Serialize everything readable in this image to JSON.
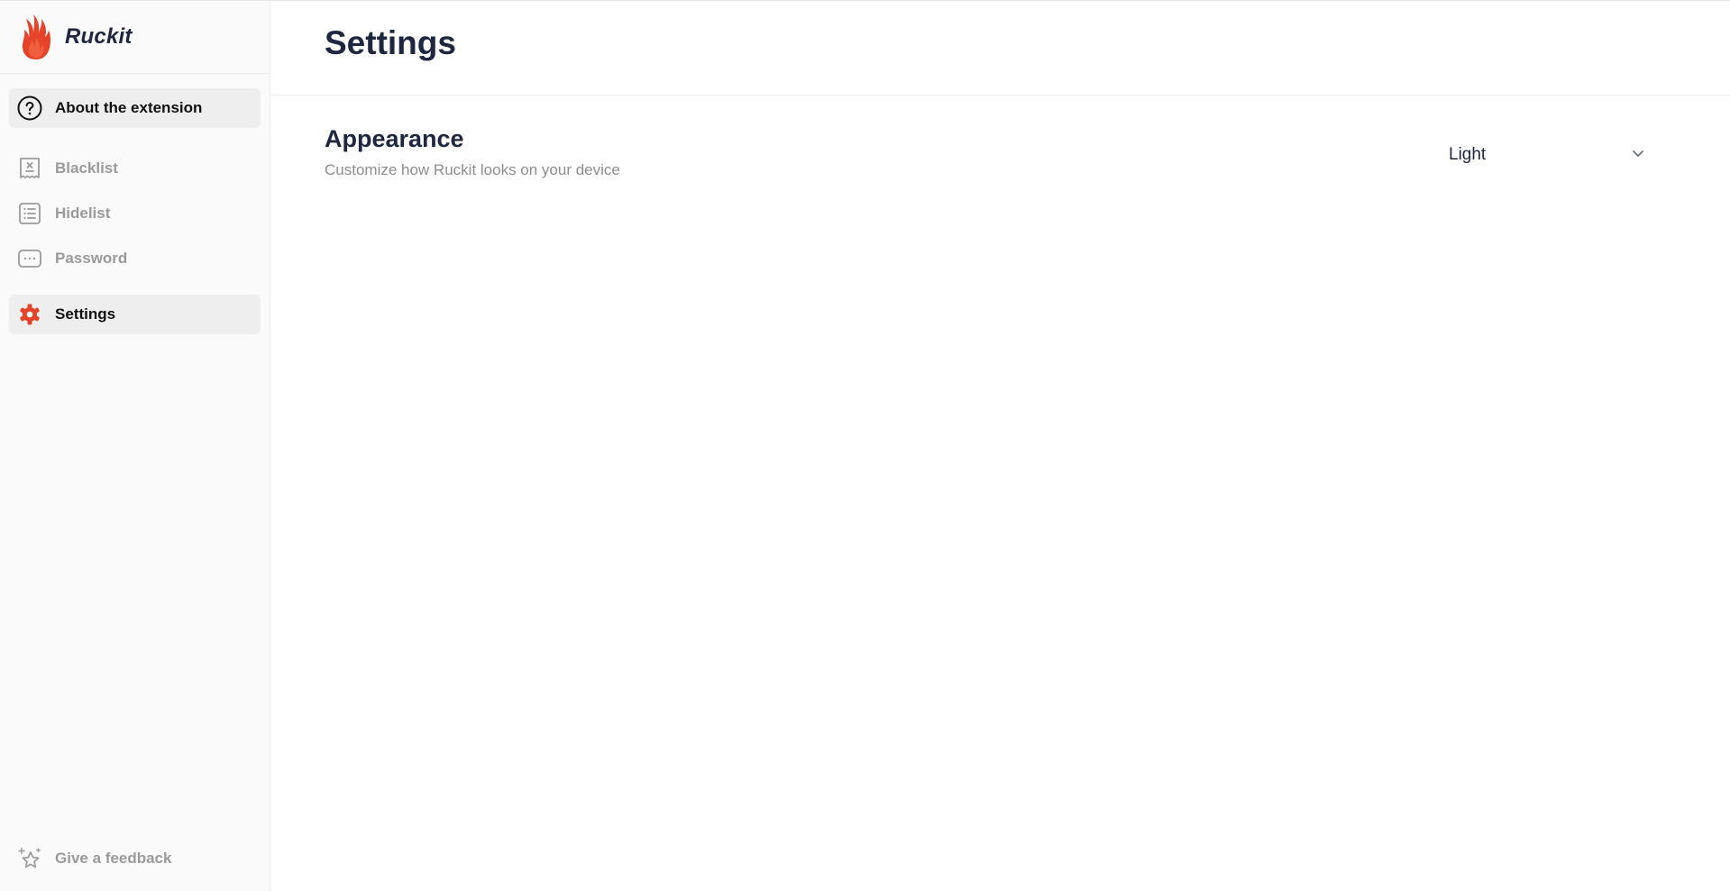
{
  "brand": {
    "name": "Ruckit",
    "accent_color": "#e5432a"
  },
  "sidebar": {
    "items": [
      {
        "id": "about",
        "label": "About the extension",
        "icon": "help-circle-icon",
        "active": true
      },
      {
        "id": "blacklist",
        "label": "Blacklist",
        "icon": "blacklist-icon",
        "active": false
      },
      {
        "id": "hidelist",
        "label": "Hidelist",
        "icon": "list-icon",
        "active": false
      },
      {
        "id": "password",
        "label": "Password",
        "icon": "password-icon",
        "active": false
      },
      {
        "id": "settings",
        "label": "Settings",
        "icon": "gear-icon",
        "active": true
      }
    ],
    "feedback": {
      "label": "Give a feedback",
      "icon": "sparkle-star-icon"
    }
  },
  "main": {
    "title": "Settings",
    "appearance": {
      "title": "Appearance",
      "description": "Customize how Ruckit looks on your device",
      "selected": "Light"
    }
  }
}
